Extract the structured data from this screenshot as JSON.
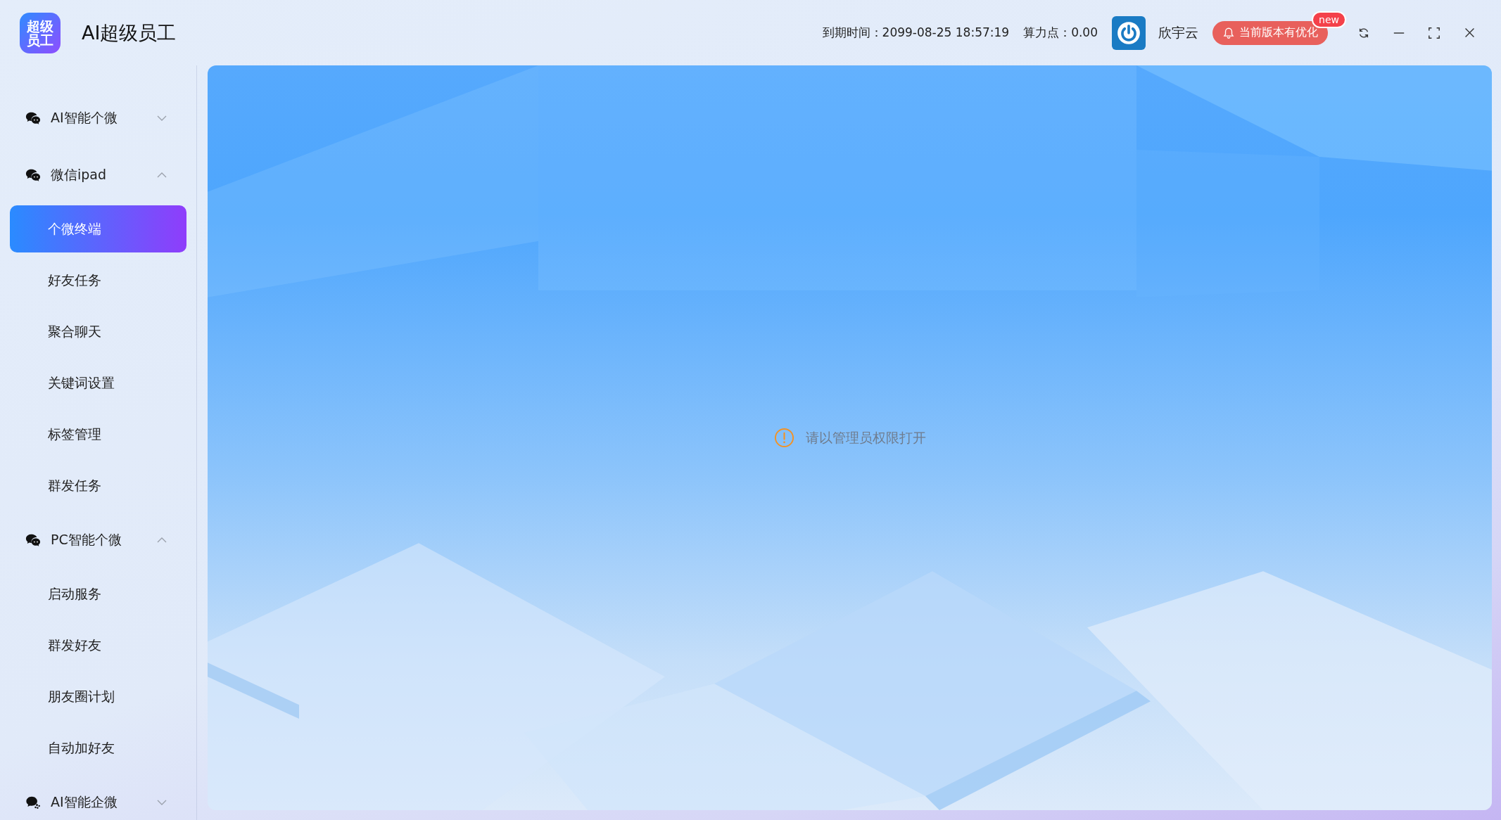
{
  "app": {
    "logo_text": "超级员工",
    "title": "AI超级员工"
  },
  "header": {
    "expiry": "到期时间：2099-08-25 18:57:19",
    "points": "算力点：0.00",
    "user": "欣宇云",
    "update_notice": "当前版本有优化",
    "update_badge": "new"
  },
  "sidebar": {
    "groups": [
      {
        "label": "AI智能个微",
        "kind": "chat",
        "expanded": false
      },
      {
        "label": "微信ipad",
        "kind": "chat",
        "expanded": true,
        "items": [
          {
            "label": "个微终端",
            "selected": true
          },
          {
            "label": "好友任务",
            "selected": false
          },
          {
            "label": "聚合聊天",
            "selected": false
          },
          {
            "label": "关键词设置",
            "selected": false
          },
          {
            "label": "标签管理",
            "selected": false
          },
          {
            "label": "群发任务",
            "selected": false
          }
        ]
      },
      {
        "label": "PC智能个微",
        "kind": "chat",
        "expanded": true,
        "items": [
          {
            "label": "启动服务",
            "selected": false
          },
          {
            "label": "群发好友",
            "selected": false
          },
          {
            "label": "朋友圈计划",
            "selected": false
          },
          {
            "label": "自动加好友",
            "selected": false
          }
        ]
      },
      {
        "label": "AI智能企微",
        "kind": "enterprise",
        "expanded": false
      }
    ]
  },
  "content": {
    "kind": "picture",
    "message": "请以管理员权限打开"
  }
}
